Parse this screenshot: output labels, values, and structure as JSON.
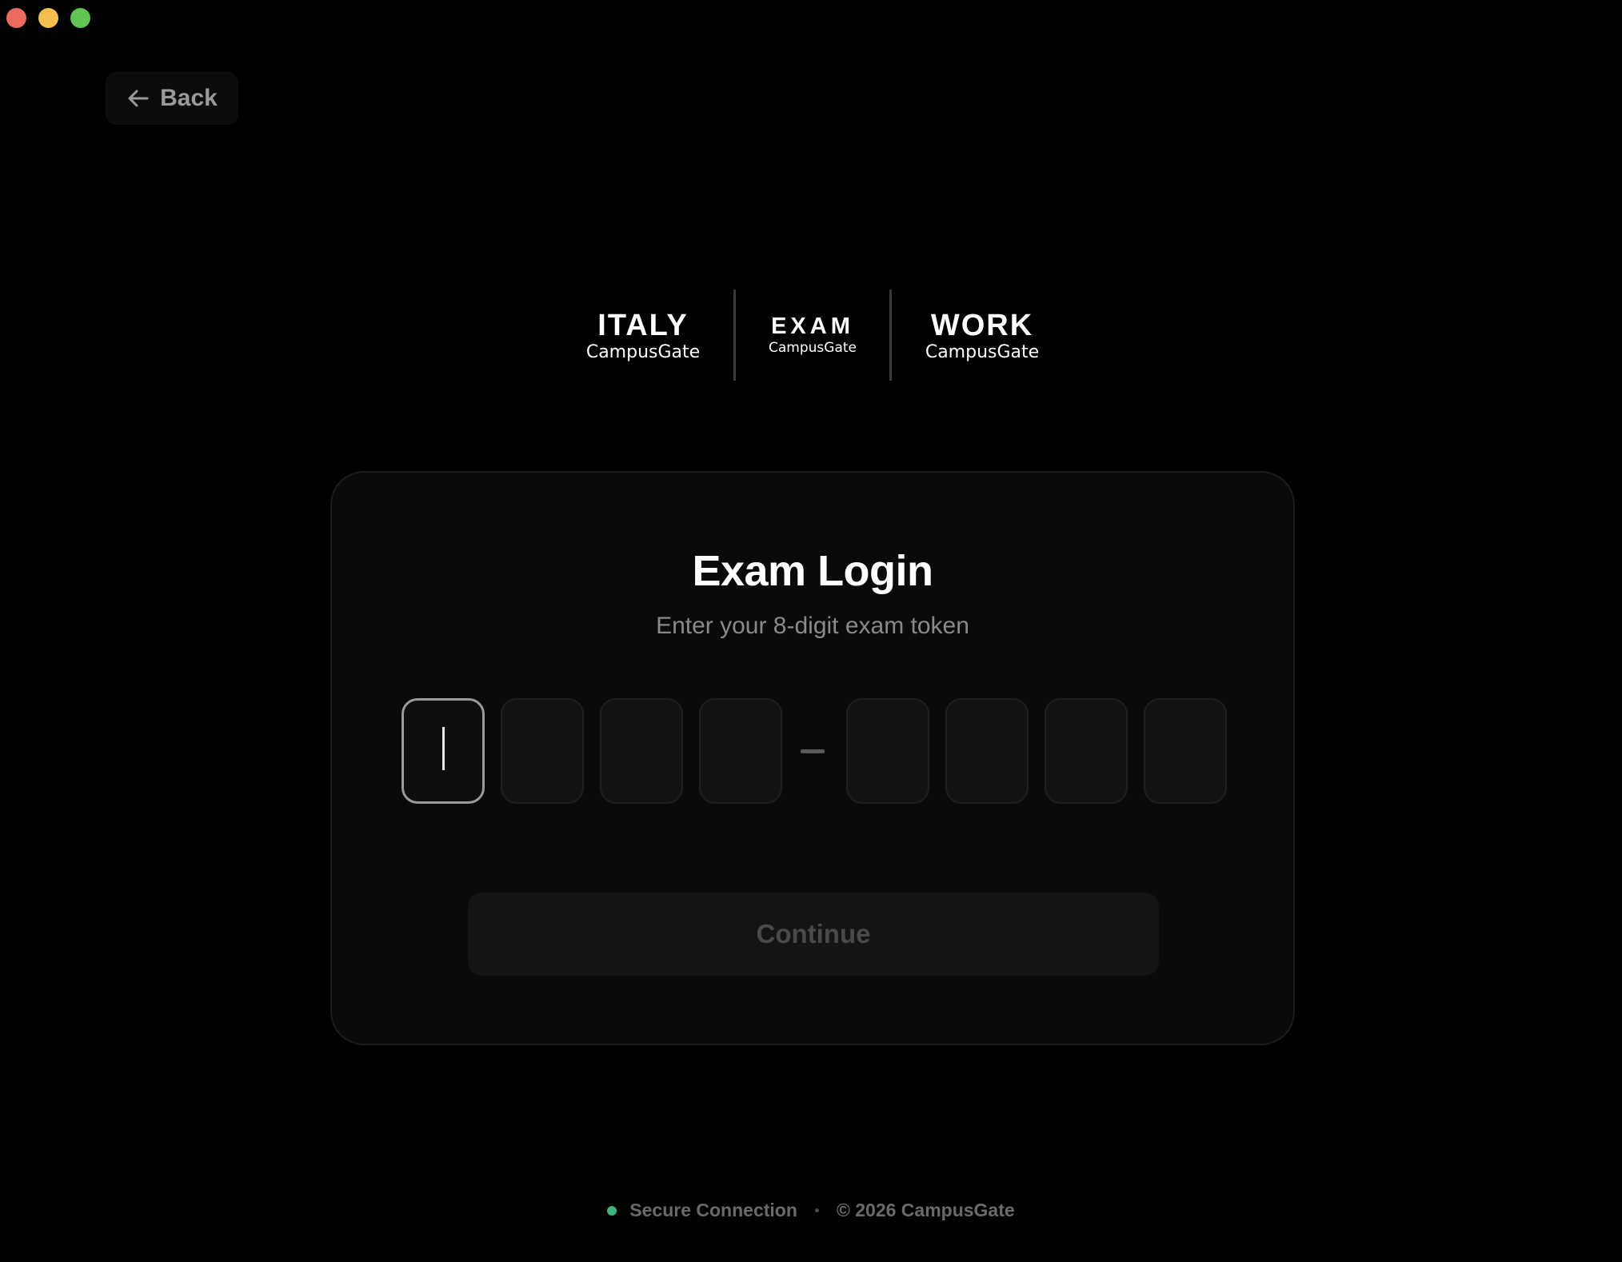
{
  "window": {
    "controls": [
      {
        "name": "close",
        "color": "#ed6a5e"
      },
      {
        "name": "minimize",
        "color": "#f5bf4f"
      },
      {
        "name": "zoom",
        "color": "#61c554"
      }
    ]
  },
  "nav": {
    "back_label": "Back",
    "back_icon": "arrow-left-icon"
  },
  "logos": [
    {
      "big": "ITALY",
      "small": "CampusGate"
    },
    {
      "big": "EXAM",
      "small": "CampusGate"
    },
    {
      "big": "WORK",
      "small": "CampusGate"
    }
  ],
  "login": {
    "title": "Exam Login",
    "subtitle": "Enter your 8-digit exam token",
    "token_digits": [
      "",
      "",
      "",
      "",
      "",
      "",
      "",
      ""
    ],
    "active_digit_index": 0,
    "continue_label": "Continue"
  },
  "footer": {
    "status_text": "Secure Connection",
    "status_color": "#3fb27f",
    "copyright": "© 2026 CampusGate"
  }
}
